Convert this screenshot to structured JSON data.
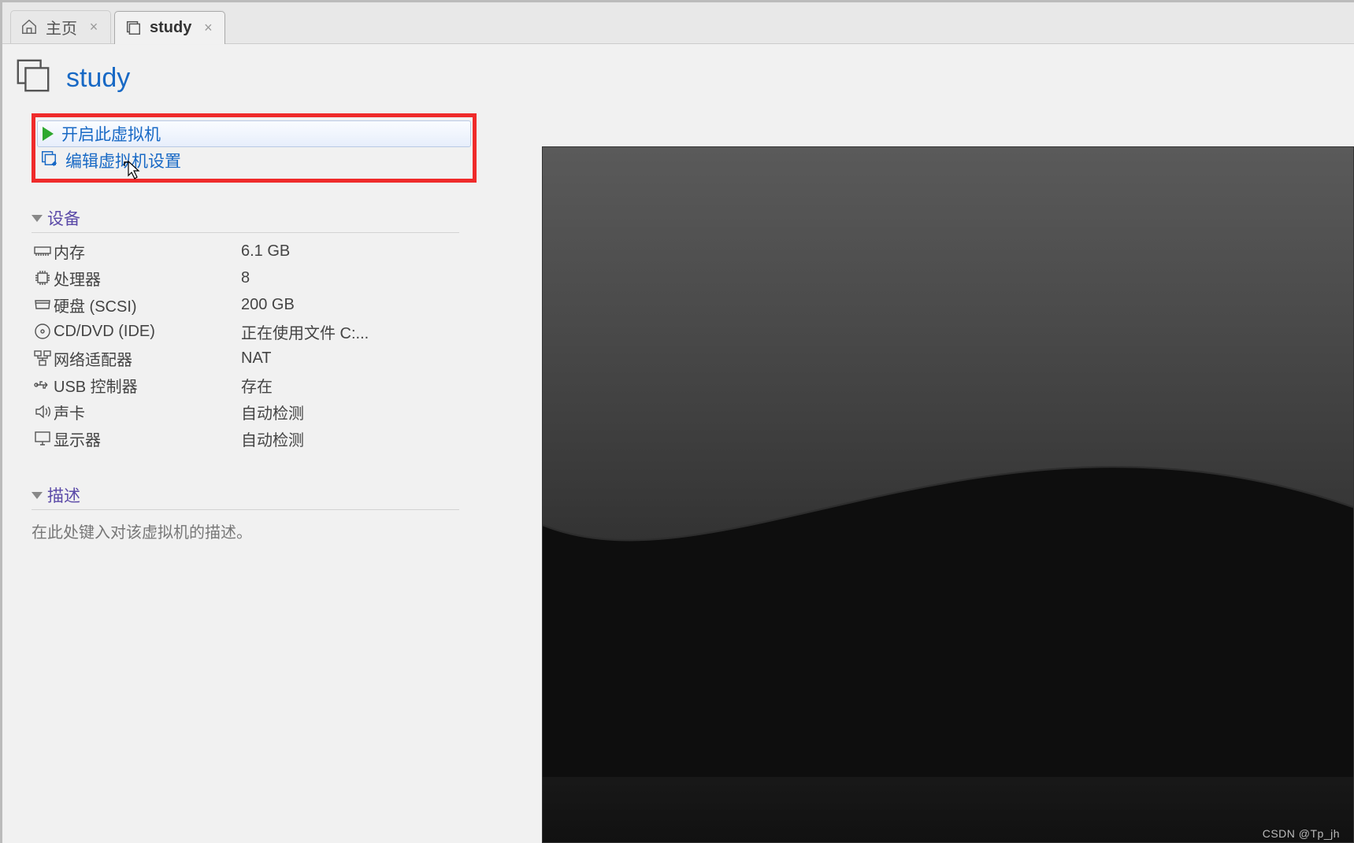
{
  "tabs": {
    "home": "主页",
    "study": "study"
  },
  "vm": {
    "title": "study",
    "actions": {
      "start": "开启此虚拟机",
      "edit": "编辑虚拟机设置"
    }
  },
  "sections": {
    "devices": "设备",
    "devices_items": [
      {
        "icon": "memory",
        "name": "内存",
        "value": "6.1 GB"
      },
      {
        "icon": "cpu",
        "name": "处理器",
        "value": "8"
      },
      {
        "icon": "disk",
        "name": "硬盘 (SCSI)",
        "value": "200 GB"
      },
      {
        "icon": "cddvd",
        "name": "CD/DVD (IDE)",
        "value": "正在使用文件 C:..."
      },
      {
        "icon": "net",
        "name": "网络适配器",
        "value": "NAT"
      },
      {
        "icon": "usb",
        "name": "USB 控制器",
        "value": "存在"
      },
      {
        "icon": "sound",
        "name": "声卡",
        "value": "自动检测"
      },
      {
        "icon": "display",
        "name": "显示器",
        "value": "自动检测"
      }
    ],
    "description": "描述",
    "description_placeholder": "在此处键入对该虚拟机的描述。"
  },
  "watermark": "CSDN @Tp_jh"
}
